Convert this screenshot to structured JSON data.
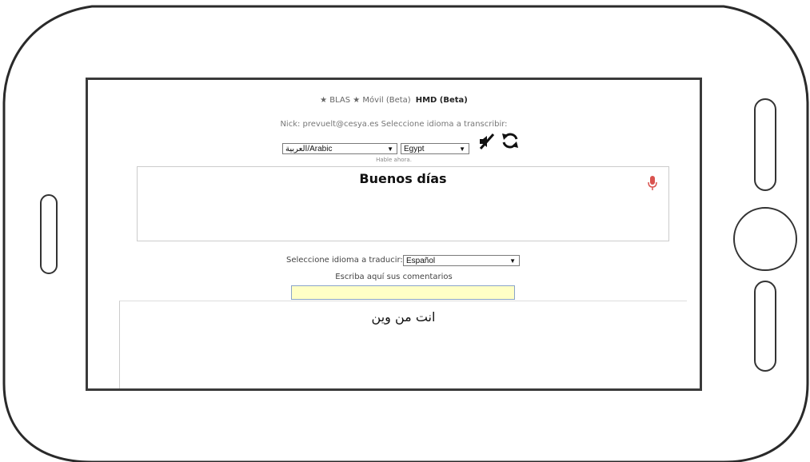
{
  "header": {
    "title": "★ BLAS ★ Móvil (Beta)",
    "hmd_label": "HMD (Beta)"
  },
  "nick_line": "Nick: prevuelt@cesya.es Seleccione idioma a transcribir:",
  "source_language": {
    "selected": "العربية/Arabic"
  },
  "source_region": {
    "selected": "Egypt"
  },
  "icons": {
    "mute": "speaker-mute-icon",
    "swap": "refresh-icon",
    "mic": "microphone-icon"
  },
  "status": "Hable ahora.",
  "transcript": "Buenos días",
  "translate": {
    "label": "Seleccione idioma a traducir:",
    "selected": "Español"
  },
  "comments": {
    "label": "Escriba aquí sus comentarios",
    "value": ""
  },
  "translation": "انت من وين",
  "colors": {
    "comment_bg": "#ffffc6",
    "mic": "#d9534f"
  }
}
